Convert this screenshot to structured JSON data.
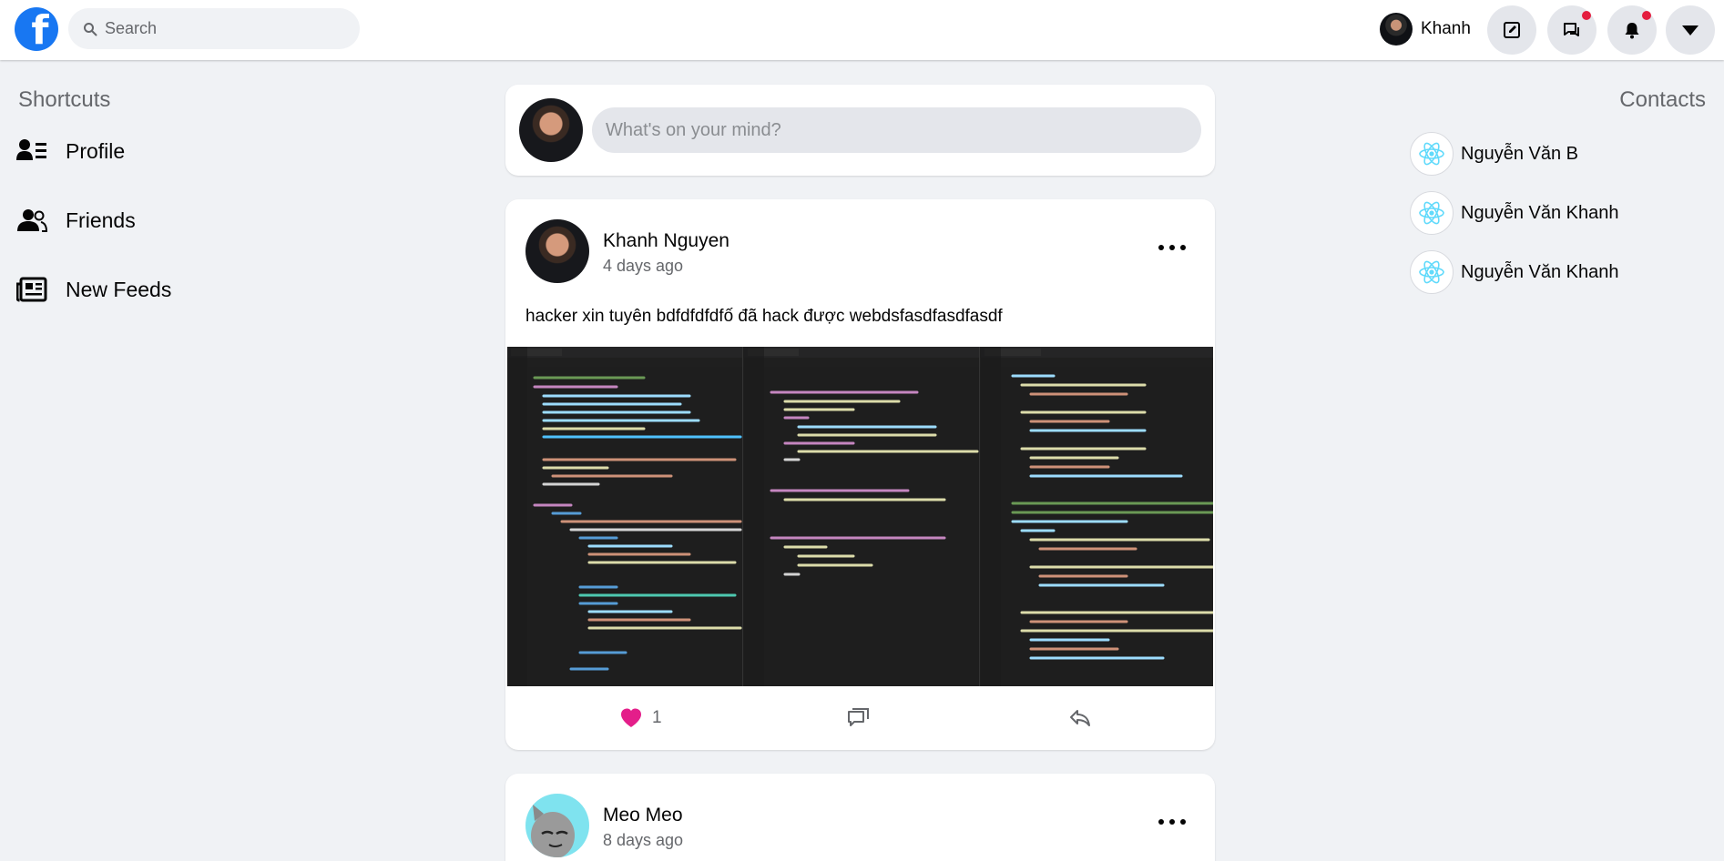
{
  "header": {
    "logo_letter": "f",
    "search_placeholder": "Search",
    "user_name": "Khanh",
    "icons": [
      "facebook-logo",
      "search-icon",
      "edit-icon",
      "messenger-icon",
      "bell-icon",
      "caret-down-icon"
    ],
    "brand_color": "#1877f2",
    "badge_color": "#e41e3f"
  },
  "shortcuts": {
    "title": "Shortcuts",
    "items": [
      {
        "label": "Profile",
        "icon": "profile-list-icon"
      },
      {
        "label": "Friends",
        "icon": "friends-icon"
      },
      {
        "label": "New Feeds",
        "icon": "newspaper-icon"
      }
    ]
  },
  "contacts": {
    "title": "Contacts",
    "items": [
      {
        "name": "Nguyễn Văn B",
        "icon": "react-logo-icon"
      },
      {
        "name": "Nguyễn Văn Khanh",
        "icon": "react-logo-icon"
      },
      {
        "name": "Nguyễn Văn Khanh",
        "icon": "react-logo-icon"
      }
    ]
  },
  "composer": {
    "placeholder": "What's on your mind?"
  },
  "posts": [
    {
      "author": "Khanh Nguyen",
      "time": "4 days ago",
      "text": "hacker xin tuyên bdfdfdfdfố đã hack được webdsfasdfasdfasdf",
      "image": "code-editor-screenshot",
      "likes": "1",
      "like_color": "#e41e8a"
    },
    {
      "author": "Meo Meo",
      "time": "8 days ago"
    }
  ]
}
